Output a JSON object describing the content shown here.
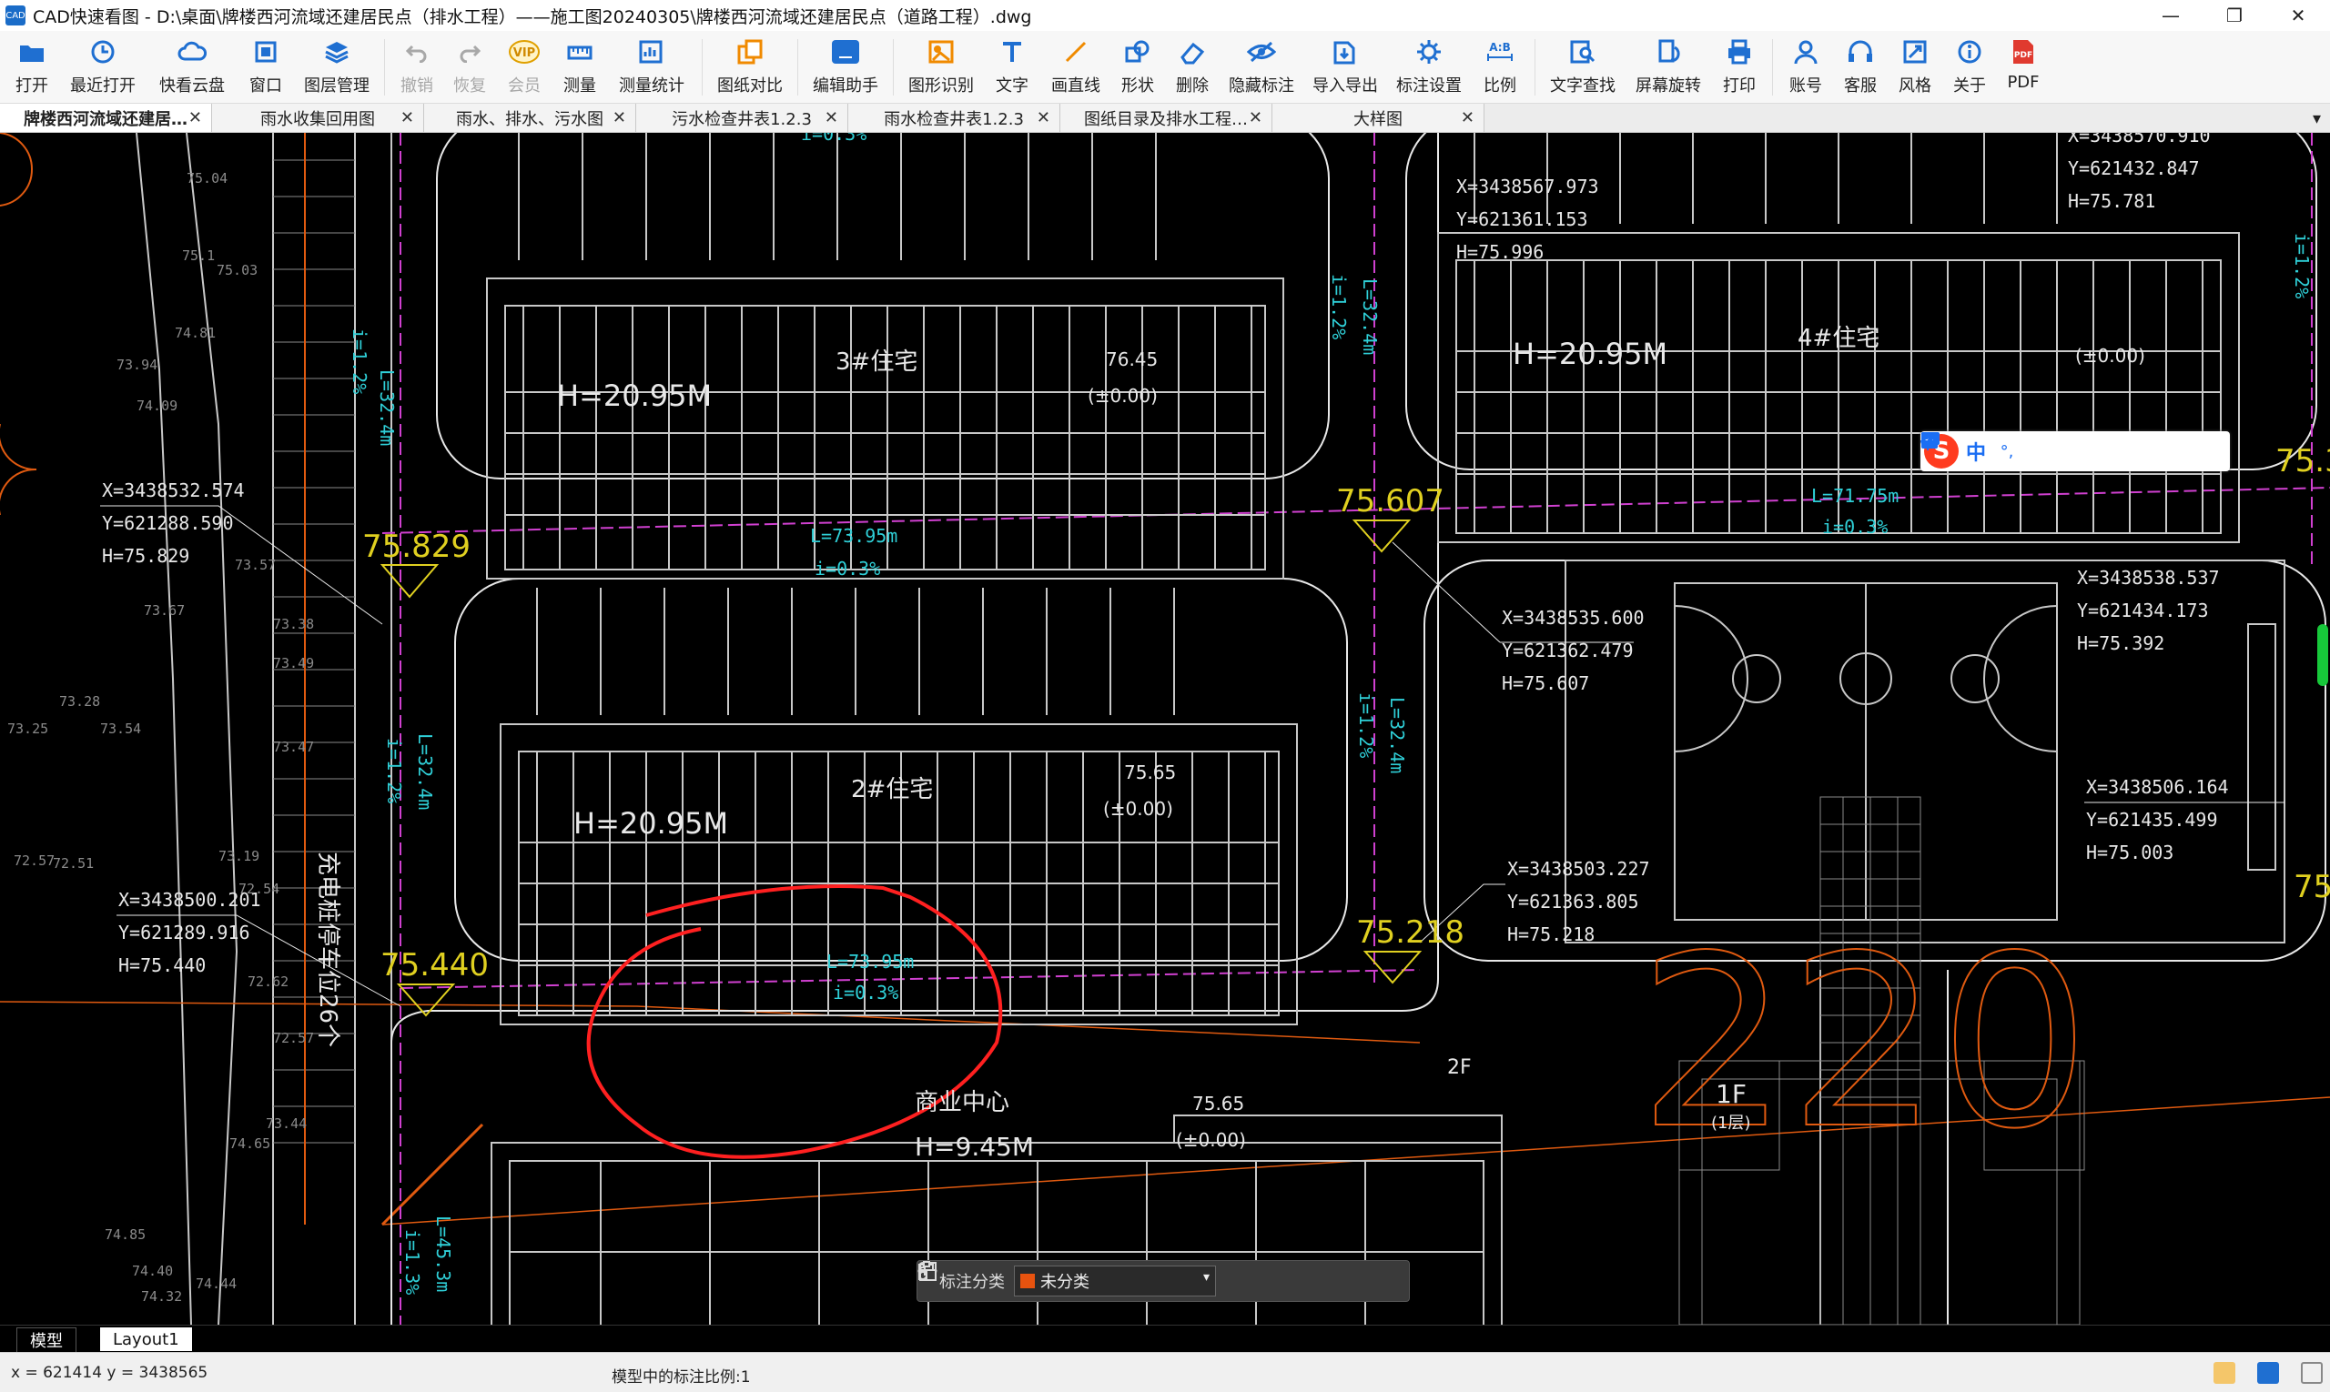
{
  "window": {
    "app_icon": "CAD",
    "title": "CAD快速看图 - D:\\桌面\\牌楼西河流域还建居民点（排水工程）——施工图20240305\\牌楼西河流域还建居民点（道路工程）.dwg",
    "minimize_glyph": "—",
    "maximize_glyph": "❐",
    "close_glyph": "✕"
  },
  "toolbar": {
    "items": [
      {
        "label": "打开",
        "icon": "folder-icon",
        "color": "#1f6fd1"
      },
      {
        "label": "最近打开",
        "icon": "clock-icon",
        "color": "#1f6fd1"
      },
      {
        "label": "快看云盘",
        "icon": "cloud-icon",
        "color": "#1f6fd1"
      },
      {
        "label": "窗口",
        "icon": "window-icon",
        "color": "#1f6fd1"
      },
      {
        "label": "图层管理",
        "icon": "layers-icon",
        "color": "#1f6fd1"
      },
      {
        "label": "撤销",
        "icon": "undo-icon",
        "color": "#a8a8a8",
        "disabled": true
      },
      {
        "label": "恢复",
        "icon": "redo-icon",
        "color": "#a8a8a8",
        "disabled": true
      },
      {
        "label": "会员",
        "icon": "vip-icon",
        "color": "#e0a000",
        "disabled": true
      },
      {
        "label": "测量",
        "icon": "measure-icon",
        "color": "#1f6fd1"
      },
      {
        "label": "测量统计",
        "icon": "measure-stats-icon",
        "color": "#1f6fd1"
      },
      {
        "label": "图纸对比",
        "icon": "compare-icon",
        "color": "#f08a00"
      },
      {
        "label": "编辑助手",
        "icon": "edit-assistant-icon",
        "color": "#1f6fd1"
      },
      {
        "label": "图形识别",
        "icon": "shape-recognize-icon",
        "color": "#f08a00"
      },
      {
        "label": "文字",
        "icon": "text-icon",
        "color": "#1f6fd1"
      },
      {
        "label": "画直线",
        "icon": "line-icon",
        "color": "#f08a00"
      },
      {
        "label": "形状",
        "icon": "shape-icon",
        "color": "#1f6fd1"
      },
      {
        "label": "删除",
        "icon": "eraser-icon",
        "color": "#1f6fd1"
      },
      {
        "label": "隐藏标注",
        "icon": "hide-annotation-icon",
        "color": "#1f6fd1"
      },
      {
        "label": "导入导出",
        "icon": "import-export-icon",
        "color": "#1f6fd1"
      },
      {
        "label": "标注设置",
        "icon": "annotation-settings-icon",
        "color": "#1f6fd1"
      },
      {
        "label": "比例",
        "icon": "scale-icon",
        "color": "#1f6fd1"
      },
      {
        "label": "文字查找",
        "icon": "text-search-icon",
        "color": "#1f6fd1"
      },
      {
        "label": "屏幕旋转",
        "icon": "rotate-icon",
        "color": "#1f6fd1"
      },
      {
        "label": "打印",
        "icon": "print-icon",
        "color": "#1f6fd1"
      },
      {
        "label": "账号",
        "icon": "account-icon",
        "color": "#1f6fd1"
      },
      {
        "label": "客服",
        "icon": "headset-icon",
        "color": "#1f6fd1"
      },
      {
        "label": "风格",
        "icon": "style-icon",
        "color": "#1f6fd1"
      },
      {
        "label": "关于",
        "icon": "info-icon",
        "color": "#1f6fd1"
      },
      {
        "label": "PDF",
        "icon": "pdf-icon",
        "color": "#e03a2f"
      }
    ],
    "vip_text": "VIP",
    "ab_text": "A:B",
    "pdf_text": "PDF"
  },
  "tabs": [
    {
      "label": "牌楼西河流域还建居…",
      "active": true
    },
    {
      "label": "雨水收集回用图"
    },
    {
      "label": "雨水、排水、污水图"
    },
    {
      "label": "污水检查井表1.2.3"
    },
    {
      "label": "雨水检查井表1.2.3"
    },
    {
      "label": "图纸目录及排水工程…"
    },
    {
      "label": "大样图"
    }
  ],
  "tab_close": "✕",
  "tab_menu": "▾",
  "drawing": {
    "colors": {
      "building": "#c8c8c8",
      "road": "#e8e8e8",
      "cyan": "#2fd0d8",
      "yellow": "#e0d020",
      "magenta": "#d040d0",
      "orange": "#e05a10",
      "red": "#ff2020",
      "dim": "#8a8a8a"
    },
    "texts": {
      "coord1": [
        "X=3438532.574",
        "Y=621288.590",
        "H=75.829"
      ],
      "coord2": [
        "X=3438500.201",
        "Y=621289.916",
        "H=75.440"
      ],
      "coord3": [
        "X=3438567.973",
        "Y=621361.153",
        "H=75.996"
      ],
      "coord4": [
        "X=3438535.600",
        "Y=621362.479",
        "H=75.607"
      ],
      "coord5": [
        "X=3438503.227",
        "Y=621363.805",
        "H=75.218"
      ],
      "coord6": [
        "X=3438570.910",
        "Y=621432.847",
        "H=75.781"
      ],
      "coord7": [
        "X=3438538.537",
        "Y=621434.173",
        "H=75.392"
      ],
      "coord8": [
        "X=3438506.164",
        "Y=621435.499",
        "H=75.003"
      ],
      "elev_829": "75.829",
      "elev_440": "75.440",
      "elev_607": "75.607",
      "elev_218": "75.218",
      "elev_3": "75.3",
      "elev_e": "75.",
      "pipe_top_L": "L=73.95m",
      "pipe_top_i": "i=0.3%",
      "pipe_mid_L": "L=73.95m",
      "pipe_mid_i": "i=0.3%",
      "pipe_right_L": "L=71.75m",
      "pipe_right_i": "i=0.3%",
      "pipe_bottom_L": "L=73.95m",
      "pipe_bottom_i": "i=0.3%",
      "top_i": "i=0.3%",
      "v_L1": "L=32.4m",
      "v_i1": "i=1.2%",
      "v_L2": "L=32.4m",
      "v_i2": "i=1.2%",
      "v_L3": "L=32.4m",
      "v_i3": "i=1.2%",
      "v_L4": "L=32.4m",
      "v_i4": "i=1.2%",
      "v_L5": "L=45.3m",
      "v_i5": "i=1.3%",
      "v_i_far": "i=1.2%",
      "bldg1_h": "H=20.95M",
      "bldg1_name": "3#住宅",
      "bldg1_elev": "76.45",
      "bldg1_zero": "(±0.00)",
      "bldg2_h": "H=20.95M",
      "bldg2_name": "2#住宅",
      "bldg2_elev": "75.65",
      "bldg2_zero": "(±0.00)",
      "bldg3_h": "H=20.95M",
      "bldg3_name": "4#住宅",
      "bldg3_zero": "(±0.00)",
      "bldg4_name": "商业中心",
      "bldg4_h": "H=9.45M",
      "bldg4_elev": "75.65",
      "bldg4_zero": "(±0.00)",
      "bldg4_2f": "2F",
      "onef": "1F",
      "onef_sub": "(1层)",
      "parking": "充电桩停车位26个",
      "big_number": "220",
      "terrain": [
        "75.04",
        "74.81",
        "73.94",
        "74.09",
        "73.57",
        "73.28",
        "73.54",
        "73.25",
        "72.51",
        "73.19",
        "72.54",
        "72.62",
        "72.57",
        "73.44",
        "74.65",
        "74.85",
        "74.40",
        "74.44",
        "74.32",
        "75.1",
        "75.03",
        "73.67",
        "72.57",
        "73.38",
        "73.49",
        "73.47"
      ]
    }
  },
  "annotation_bar": {
    "label": "标注分类",
    "selected": "未分类",
    "swatch_color": "#e8530f"
  },
  "ime": {
    "logo": "S",
    "mode": "中",
    "punct": "°,"
  },
  "layout_tabs": {
    "model": "模型",
    "layout1": "Layout1"
  },
  "status": {
    "coords": "x = 621414  y = 3438565",
    "scale": "模型中的标注比例:1"
  }
}
